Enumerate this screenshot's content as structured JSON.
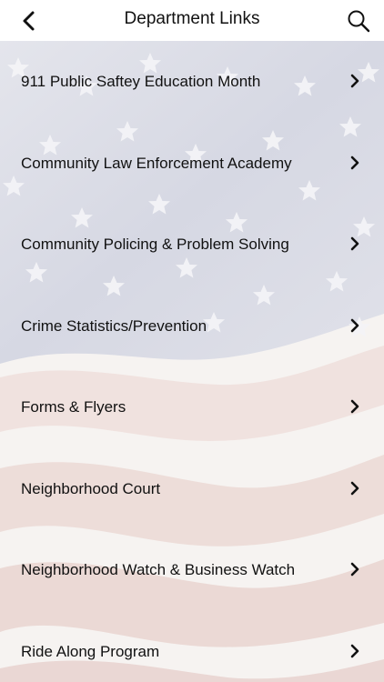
{
  "header": {
    "title": "Department Links",
    "back_icon": "chevron-left-icon",
    "search_icon": "search-icon"
  },
  "links": [
    {
      "label": "911 Public Saftey Education Month"
    },
    {
      "label": "Community Law Enforcement Academy"
    },
    {
      "label": "Community Policing & Problem Solving"
    },
    {
      "label": "Crime Statistics/Prevention"
    },
    {
      "label": "Forms & Flyers"
    },
    {
      "label": "Neighborhood Court"
    },
    {
      "label": "Neighborhood Watch & Business Watch"
    },
    {
      "label": "Ride Along Program"
    }
  ],
  "colors": {
    "header_bg": "#ffffff",
    "text": "#111111",
    "flag_blue": "#d9dbe6",
    "flag_red": "#efe1de",
    "flag_white": "#f7f5f3"
  }
}
